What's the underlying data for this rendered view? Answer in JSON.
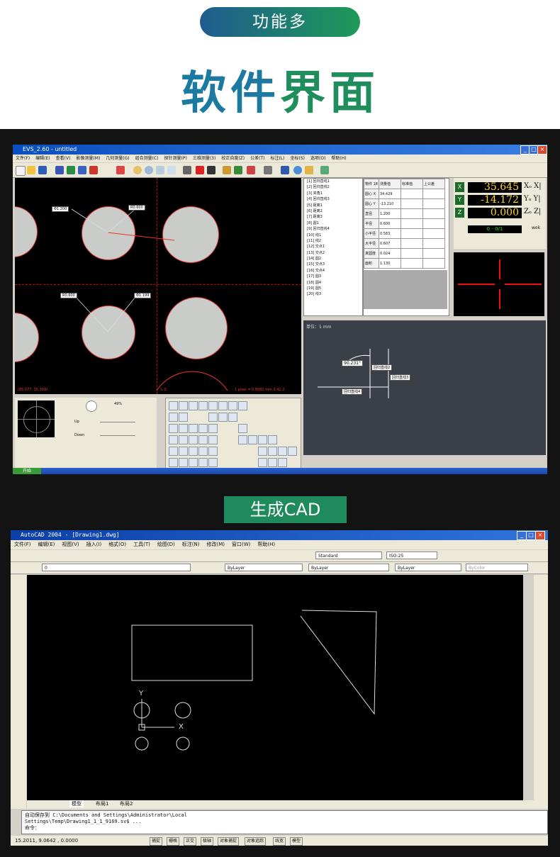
{
  "header": {
    "pill": "功能多",
    "title_a": "软件",
    "title_b": "界面"
  },
  "evs": {
    "title": "EVS_2.60 - untitled",
    "menu": [
      "文件(F)",
      "编辑(E)",
      "查看(V)",
      "影像测量(M)",
      "几何测量(G)",
      "组合测量(C)",
      "探针测量(P)",
      "三维测量(3)",
      "校正自度(Z)",
      "公差(T)",
      "标注(L)",
      "坐标(S)",
      "选项(O)",
      "帮助(H)"
    ],
    "labels": {
      "c1": "Φ1.200",
      "c2": "R0.600",
      "c3": "R0.600",
      "c4": "Φ1.199"
    },
    "status_left": "(85.077, 35.309)",
    "status_mid": "L:0",
    "status_right": "1 pixel = 0.0082 mm  3:41.2",
    "list_items": [
      "[1] 回归直线1",
      "[2] 回归直线2",
      "[3] 夹角1",
      "[4] 回归直线3",
      "[5] 距离1",
      "[6] 距离2",
      "[7] 距离3",
      "[8] 圆1",
      "[9] 回归直线4",
      "[10] 线1",
      "[11] 线2",
      "[12] 交点1",
      "[13] 交点2",
      "[14] 圆2",
      "[15] 交点3",
      "[16] 交点4",
      "[17] 圆3",
      "[18] 圆4",
      "[19] 圆5",
      "[20] 线3"
    ],
    "grid_headers": [
      "物件 18",
      "测量值",
      "标准值",
      "上公差"
    ],
    "grid_rows": [
      [
        "圆心 X",
        "34.429"
      ],
      [
        "圆心 Y",
        "-13.210"
      ],
      [
        "直径",
        "1.200"
      ],
      [
        "半径",
        "0.600"
      ],
      [
        "小半径",
        "0.583"
      ],
      [
        "大半径",
        "0.607"
      ],
      [
        "真圆度",
        "0.024"
      ],
      [
        "面积",
        "1.130"
      ]
    ],
    "dro": {
      "x_axis": "X",
      "x_value": "35.645",
      "x_suffix": "Xₒ X|",
      "y_axis": "Y",
      "y_value": "-14.172",
      "y_suffix": "Yₒ Y|",
      "z_axis": "Z",
      "z_value": "0.000",
      "z_suffix": "Zₒ Z|",
      "counter": "0 - 0/1",
      "mode": "wok"
    },
    "drawing": {
      "unit": "单位：1 mm",
      "angle": "90.231°",
      "t1": "回归直线2",
      "t2": "回归直线3",
      "t3": "回归直线4"
    },
    "panel": {
      "zoom": "49%",
      "up": "Up",
      "down": "Down"
    },
    "taskbar_start": "开始"
  },
  "sub_title": "生成CAD",
  "cad": {
    "title": "AutoCAD 2004 - [Drawing1.dwg]",
    "menu": [
      "文件(F)",
      "编辑(E)",
      "视图(V)",
      "插入(I)",
      "格式(O)",
      "工具(T)",
      "绘图(D)",
      "标注(N)",
      "修改(M)",
      "窗口(W)",
      "帮助(H)"
    ],
    "style": "Standard",
    "dim": "ISO-25",
    "layer": "0",
    "bylayer1": "ByLayer",
    "bylayer2": "ByLayer",
    "bylayer3": "ByLayer",
    "bycolor": "ByColor",
    "tabs": [
      "模型",
      "布局1",
      "布局2"
    ],
    "cmd1": "自动保存到 C:\\Documents and Settings\\Administrator\\Local",
    "cmd2": "Settings\\Temp\\Drawing1_1_1_9169.sv$ ...",
    "cmd3": "命令：",
    "coords": "15.2011,  9.0642 ,  0.0000",
    "status": [
      "捕捉",
      "栅格",
      "正交",
      "极轴",
      "对象捕捉",
      "对象追踪",
      "线宽",
      "模型"
    ],
    "ucs_y": "Y",
    "ucs_x": "X"
  }
}
